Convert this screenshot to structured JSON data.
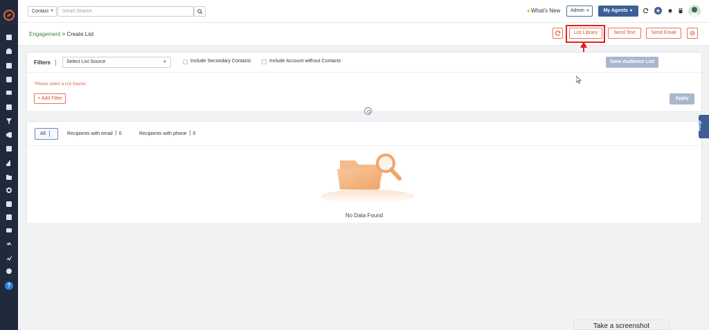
{
  "topbar": {
    "search_type": "Contact",
    "search_placeholder": "Smart Search",
    "whats_new": "What's New",
    "role": "Admin",
    "my_agents": "My Agents"
  },
  "breadcrumb": {
    "parent": "Engagement",
    "separator": ">",
    "current": "Create List"
  },
  "header_actions": {
    "list_library": "List Library",
    "send_text": "Send Text",
    "send_email": "Send Email"
  },
  "filters": {
    "title": "Filters",
    "list_source_placeholder": "Select List Source",
    "include_secondary": "Include Secondary Contacts",
    "include_account": "Include Account without Contacts",
    "save_audience": "Save Audience List",
    "warning": "*Please select a List Source",
    "add_filter": "+ Add Filter",
    "apply": "Apply"
  },
  "results": {
    "tab_all": "All",
    "tab_email": "Recipients with email",
    "tab_email_count": "0",
    "tab_phone": "Recipients with phone",
    "tab_phone_count": "0",
    "empty_message": "No Data Found"
  },
  "help_tab": "Help",
  "screenshot_toast": "Take a screenshot",
  "colors": {
    "sidebar": "#1f2a3c",
    "primary": "#3e5f95",
    "accent": "#d8502f",
    "highlight": "#e2201b",
    "disabled_button": "#a9b6cd"
  }
}
